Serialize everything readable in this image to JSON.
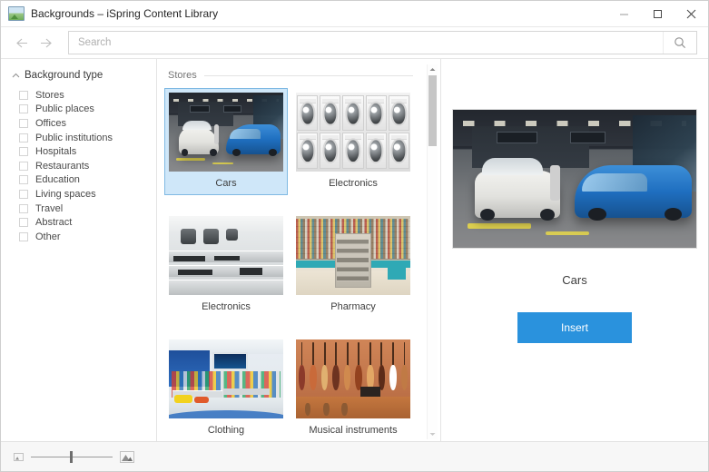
{
  "window": {
    "title": "Backgrounds – iSpring Content Library",
    "icon": "image-icon",
    "minimize_label": "Minimize",
    "maximize_label": "Maximize",
    "close_label": "Close"
  },
  "toolbar": {
    "back_label": "←",
    "forward_label": "→",
    "search_placeholder": "Search",
    "search_value": "",
    "search_icon": "search-icon"
  },
  "sidebar": {
    "facet_title": "Background type",
    "collapse_icon": "chevron-up-icon",
    "items": [
      {
        "label": "Stores",
        "checked": false
      },
      {
        "label": "Public places",
        "checked": false
      },
      {
        "label": "Offices",
        "checked": false
      },
      {
        "label": "Public institutions",
        "checked": false
      },
      {
        "label": "Hospitals",
        "checked": false
      },
      {
        "label": "Restaurants",
        "checked": false
      },
      {
        "label": "Education",
        "checked": false
      },
      {
        "label": "Living spaces",
        "checked": false
      },
      {
        "label": "Travel",
        "checked": false
      },
      {
        "label": "Abstract",
        "checked": false
      },
      {
        "label": "Other",
        "checked": false
      }
    ]
  },
  "grid": {
    "section_title": "Stores",
    "cards": [
      {
        "label": "Cars",
        "scene": "sc-cars",
        "selected": true
      },
      {
        "label": "Electronics",
        "scene": "sc-wash",
        "selected": false
      },
      {
        "label": "Electronics",
        "scene": "sc-elec",
        "selected": false
      },
      {
        "label": "Pharmacy",
        "scene": "sc-phar",
        "selected": false
      },
      {
        "label": "Clothing",
        "scene": "sc-cloth",
        "selected": false
      },
      {
        "label": "Musical instruments",
        "scene": "sc-music",
        "selected": false
      }
    ],
    "scrollbar": {
      "up_icon": "caret-up-icon",
      "down_icon": "caret-down-icon"
    }
  },
  "preview": {
    "caption": "Cars",
    "scene": "sc-cars",
    "insert_label": "Insert"
  },
  "statusbar": {
    "zoom_out_icon": "small-image-icon",
    "zoom_in_icon": "large-image-icon",
    "zoom_value": 50
  },
  "colors": {
    "accent": "#2a92dd",
    "selection_bg": "#cfe7f9",
    "selection_border": "#7fb9e3",
    "panel_border": "#e4e4e4",
    "status_bg": "#f7f7f7"
  }
}
